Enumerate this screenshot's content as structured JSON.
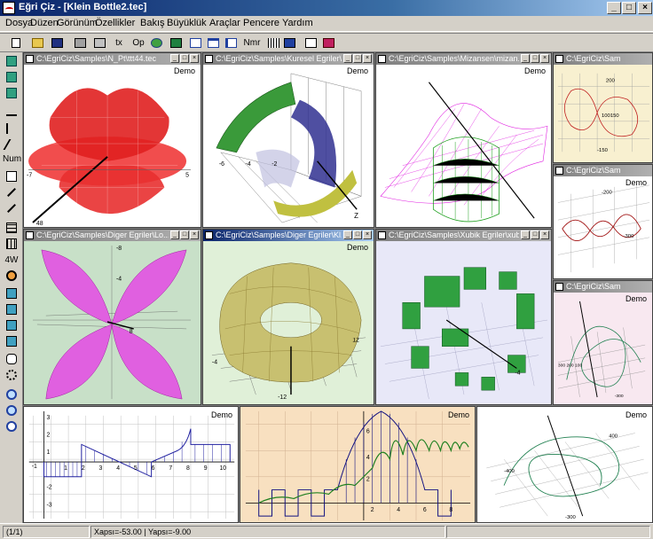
{
  "window": {
    "title": "Eğri Çiz - [Klein Bottle2.tec]",
    "minimize": "_",
    "maximize": "□",
    "close": "×"
  },
  "menu": [
    "Dosya",
    "Düzen",
    "Görünüm",
    "Özellikler",
    "Bakış",
    "Büyüklük",
    "Araçlar",
    "Pencere",
    "Yardım"
  ],
  "toolbar": {
    "tx": "tx",
    "op": "Op",
    "nmr": "Nmr"
  },
  "lefttoolbar": {
    "num": "Num",
    "fourw": "4W"
  },
  "demo_label": "Demo",
  "subwindows": [
    {
      "title": "C:\\EgriCiz\\Samples\\N_Pt\\ttt44.tec"
    },
    {
      "title": "C:\\EgriCiz\\Samples\\Kuresel Egriler\\..."
    },
    {
      "title": "C:\\EgriCiz\\Samples\\Mizansen\\mizan..."
    },
    {
      "title": "C:\\EgriCiz\\Samples\\..."
    },
    {
      "title": "C:\\EgriCiz\\Samples\\..."
    },
    {
      "title": "C:\\EgriCiz\\Samples\\Diger Egriler\\Lo..."
    },
    {
      "title": "C:\\EgriCiz\\Samples\\Diger Egriler\\Kl..."
    },
    {
      "title": "C:\\EgriCiz\\Samples\\Xubik Egriler\\xub..."
    },
    {
      "title": "C:\\EgriCiz\\Samples\\..."
    }
  ],
  "status": {
    "page": "(1/1)",
    "coords": "Xapsı=-53.00 | Yapsı=-9.00"
  },
  "colors": {
    "title_active": "#0a246a",
    "face": "#d4d0c8",
    "mdi": "#808080"
  }
}
